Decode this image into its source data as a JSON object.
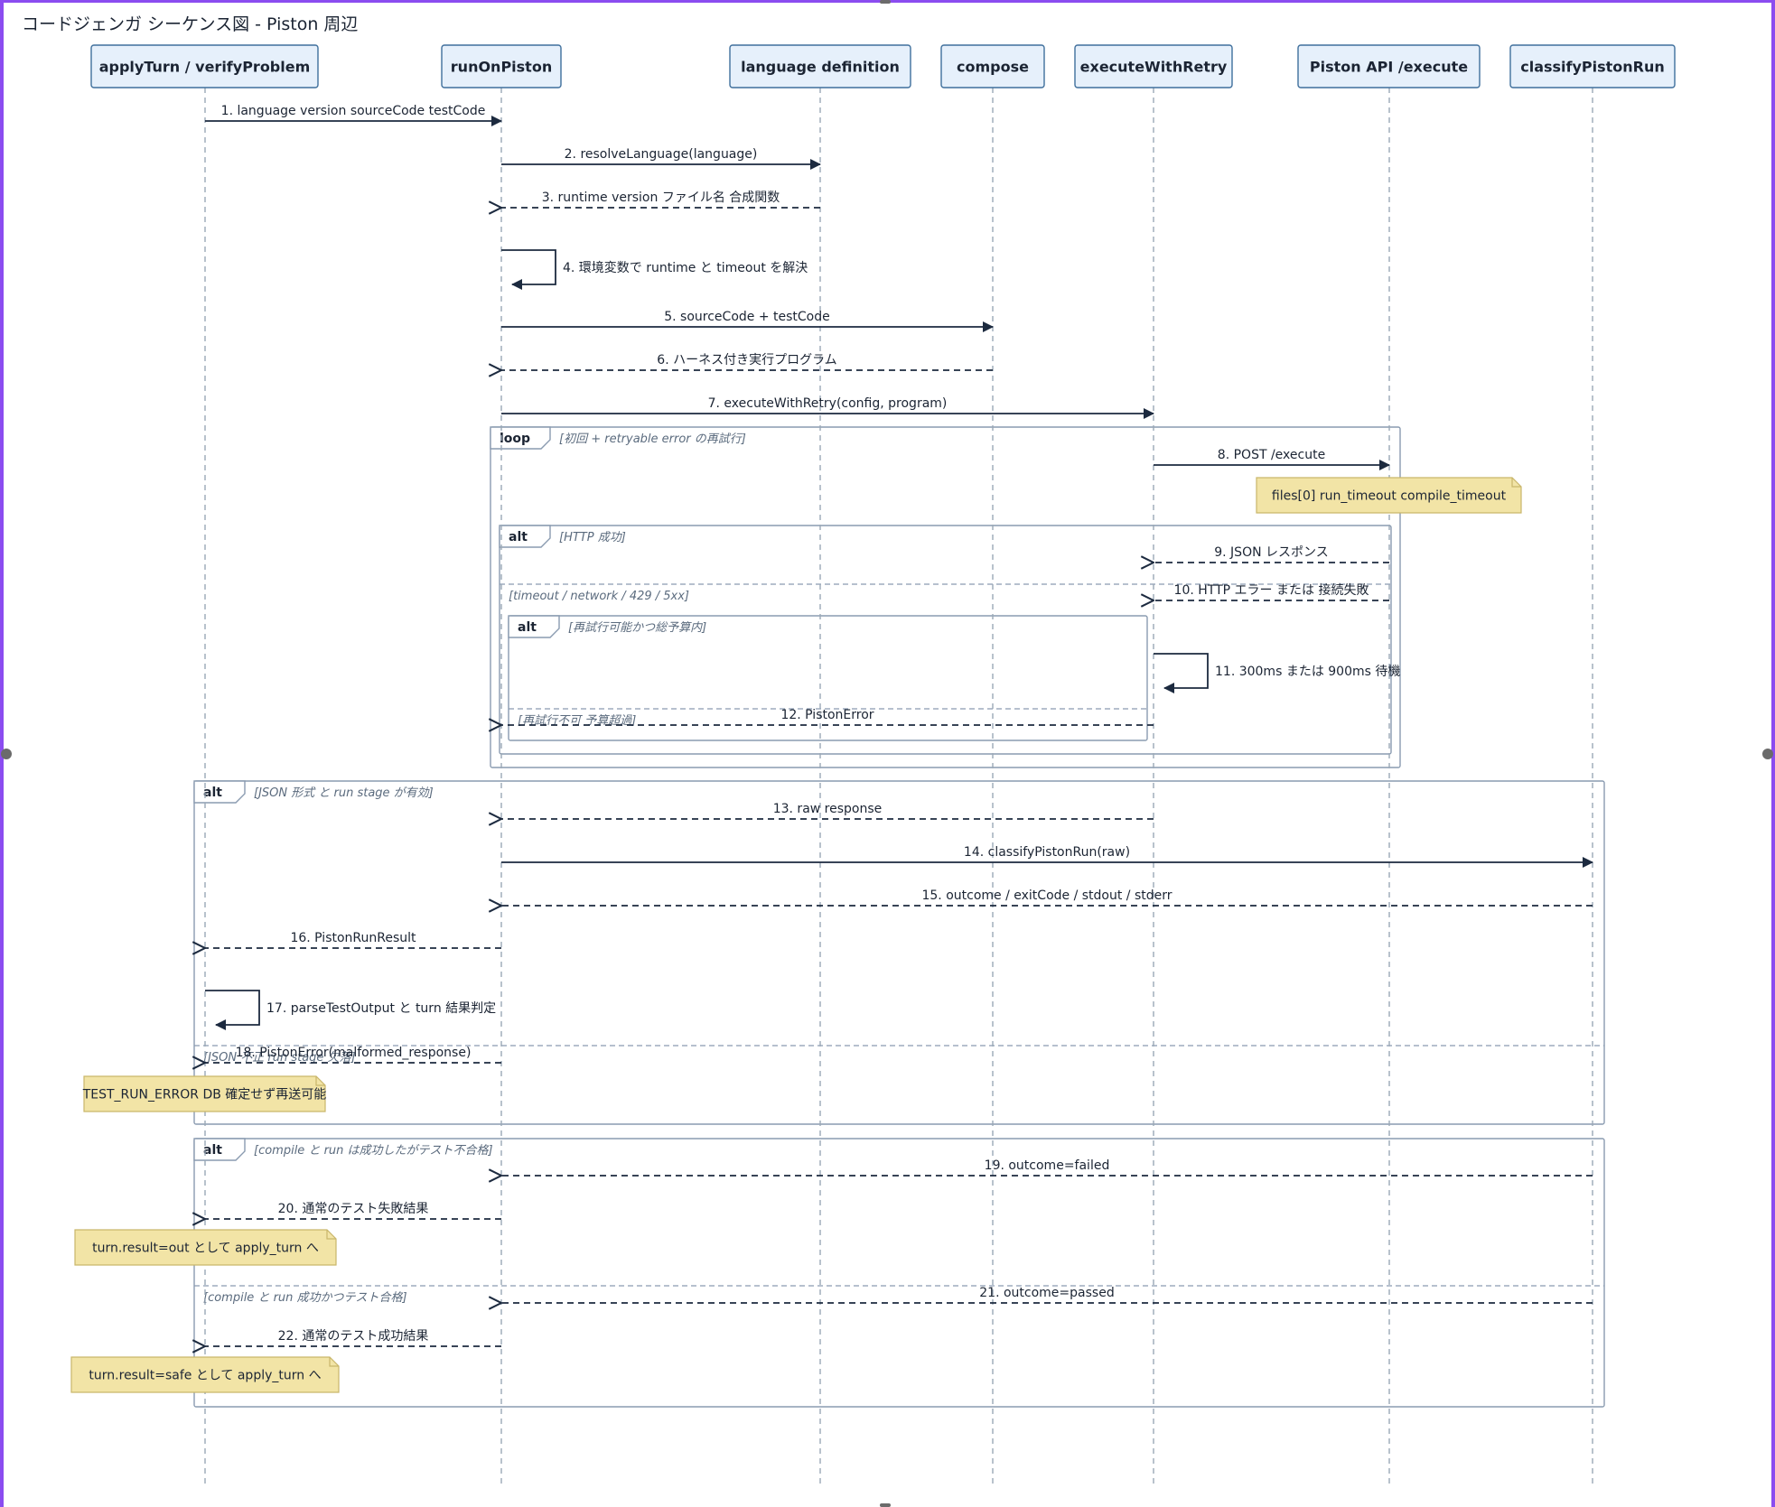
{
  "title": "コードジェンガ シーケンス図 - Piston 周辺",
  "participants": [
    {
      "id": "apply",
      "label": "applyTurn / verifyProblem"
    },
    {
      "id": "run",
      "label": "runOnPiston"
    },
    {
      "id": "lang",
      "label": "language definition"
    },
    {
      "id": "compose",
      "label": "compose"
    },
    {
      "id": "exec",
      "label": "executeWithRetry"
    },
    {
      "id": "api",
      "label": "Piston API /execute"
    },
    {
      "id": "classify",
      "label": "classifyPistonRun"
    }
  ],
  "messages": [
    {
      "n": 1,
      "text": "1. language version sourceCode testCode",
      "from": "apply",
      "to": "run",
      "type": "sync"
    },
    {
      "n": 2,
      "text": "2. resolveLanguage(language)",
      "from": "run",
      "to": "lang",
      "type": "sync"
    },
    {
      "n": 3,
      "text": "3. runtime version ファイル名 合成関数",
      "from": "lang",
      "to": "run",
      "type": "return"
    },
    {
      "n": 4,
      "text": "4. 環境変数で runtime と timeout を解決",
      "from": "run",
      "to": "run",
      "type": "self"
    },
    {
      "n": 5,
      "text": "5. sourceCode + testCode",
      "from": "run",
      "to": "compose",
      "type": "sync"
    },
    {
      "n": 6,
      "text": "6. ハーネス付き実行プログラム",
      "from": "compose",
      "to": "run",
      "type": "return"
    },
    {
      "n": 7,
      "text": "7. executeWithRetry(config, program)",
      "from": "run",
      "to": "exec",
      "type": "sync"
    },
    {
      "n": 8,
      "text": "8. POST /execute",
      "from": "exec",
      "to": "api",
      "type": "sync"
    },
    {
      "n": 9,
      "text": "9. JSON レスポンス",
      "from": "api",
      "to": "exec",
      "type": "return"
    },
    {
      "n": 10,
      "text": "10. HTTP エラー または 接続失敗",
      "from": "api",
      "to": "exec",
      "type": "return"
    },
    {
      "n": 11,
      "text": "11. 300ms または 900ms 待機",
      "from": "exec",
      "to": "exec",
      "type": "self"
    },
    {
      "n": 12,
      "text": "12. PistonError",
      "from": "exec",
      "to": "run",
      "type": "return"
    },
    {
      "n": 13,
      "text": "13. raw response",
      "from": "exec",
      "to": "run",
      "type": "return"
    },
    {
      "n": 14,
      "text": "14. classifyPistonRun(raw)",
      "from": "run",
      "to": "classify",
      "type": "sync"
    },
    {
      "n": 15,
      "text": "15. outcome / exitCode / stdout / stderr",
      "from": "classify",
      "to": "run",
      "type": "return"
    },
    {
      "n": 16,
      "text": "16. PistonRunResult",
      "from": "run",
      "to": "apply",
      "type": "return"
    },
    {
      "n": 17,
      "text": "17. parseTestOutput と turn 結果判定",
      "from": "apply",
      "to": "apply",
      "type": "self"
    },
    {
      "n": 18,
      "text": "18. PistonError(malformed_response)",
      "from": "run",
      "to": "apply",
      "type": "return"
    },
    {
      "n": 19,
      "text": "19. outcome=failed",
      "from": "classify",
      "to": "run",
      "type": "return"
    },
    {
      "n": 20,
      "text": "20. 通常のテスト失敗結果",
      "from": "run",
      "to": "apply",
      "type": "return"
    },
    {
      "n": 21,
      "text": "21. outcome=passed",
      "from": "classify",
      "to": "run",
      "type": "return"
    },
    {
      "n": 22,
      "text": "22. 通常のテスト成功結果",
      "from": "run",
      "to": "apply",
      "type": "return"
    }
  ],
  "fragments": [
    {
      "kw": "loop",
      "guard": "[初回 + retryable error の再試行]"
    },
    {
      "kw": "alt",
      "guard": "[HTTP 成功]",
      "else_guard": "[timeout / network / 429 / 5xx]"
    },
    {
      "kw": "alt",
      "guard": "[再試行可能かつ総予算内]",
      "else_guard": "[再試行不可 予算超過]"
    },
    {
      "kw": "alt",
      "guard": "[JSON 形式 と run stage が有効]",
      "else_guard": "[JSON 不正 run stage 欠落]"
    },
    {
      "kw": "alt",
      "guard": "[compile と run は成功したがテスト不合格]",
      "else_guard": "[compile と run 成功かつテスト合格]"
    }
  ],
  "notes": [
    {
      "text": "files[0] run_timeout compile_timeout"
    },
    {
      "text": "TEST_RUN_ERROR DB 確定せず再送可能"
    },
    {
      "text": "turn.result=out として apply_turn へ"
    },
    {
      "text": "turn.result=safe として apply_turn へ"
    }
  ]
}
